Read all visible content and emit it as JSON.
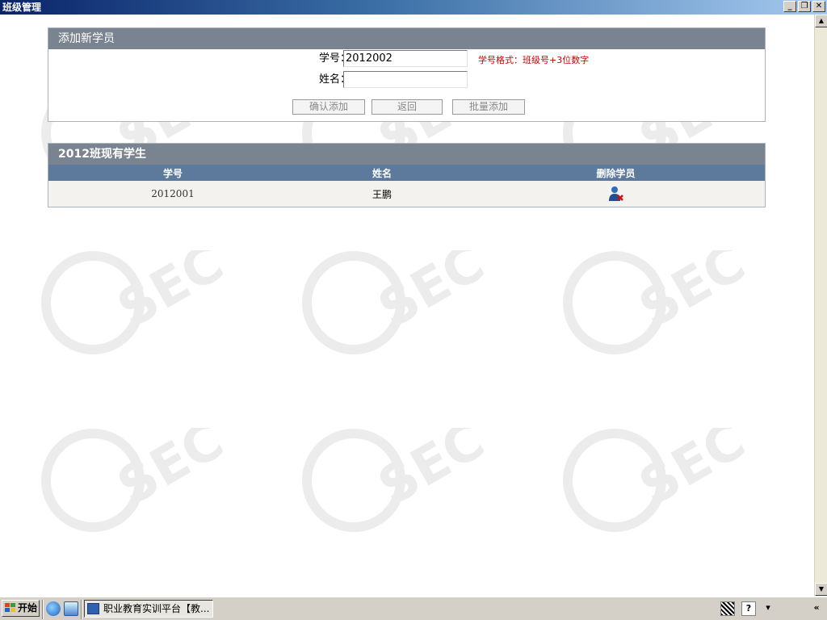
{
  "window": {
    "title": "班级管理"
  },
  "add_panel": {
    "title": "添加新学员",
    "student_id_label": "学号：",
    "student_id_value": "2012002",
    "name_label": "姓名：",
    "name_value": "",
    "hint": "学号格式：班级号+3位数字",
    "buttons": {
      "confirm": "确认添加",
      "back": "返回",
      "batch": "批量添加"
    }
  },
  "list_panel": {
    "title": "2012班现有学生",
    "columns": [
      "学号",
      "姓名",
      "删除学员"
    ],
    "rows": [
      {
        "student_id": "2012001",
        "name": "王鹏"
      }
    ]
  },
  "taskbar": {
    "start_label": "开始",
    "task_label": "职业教育实训平台【教..."
  },
  "colors": {
    "panel_header": "#7a8490",
    "table_header": "#5d7a9c",
    "hint_red": "#d00000"
  }
}
